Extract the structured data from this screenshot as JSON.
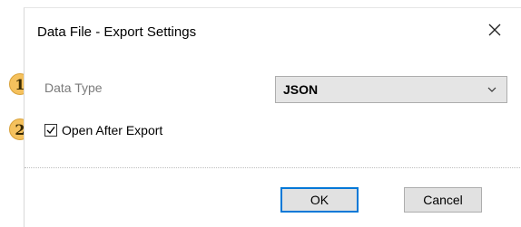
{
  "dialog": {
    "title": "Data File - Export Settings",
    "close_icon": "close-icon"
  },
  "form": {
    "data_type_label": "Data Type",
    "data_type_value": "JSON",
    "open_after_export_label": "Open After Export",
    "open_after_export_checked": true
  },
  "buttons": {
    "ok_label": "OK",
    "cancel_label": "Cancel"
  },
  "callouts": {
    "one": "1",
    "two": "2"
  },
  "colors": {
    "callout_fill": "#f5c15d",
    "callout_bracket": "#e24a4a",
    "ok_border": "#0078d7"
  }
}
